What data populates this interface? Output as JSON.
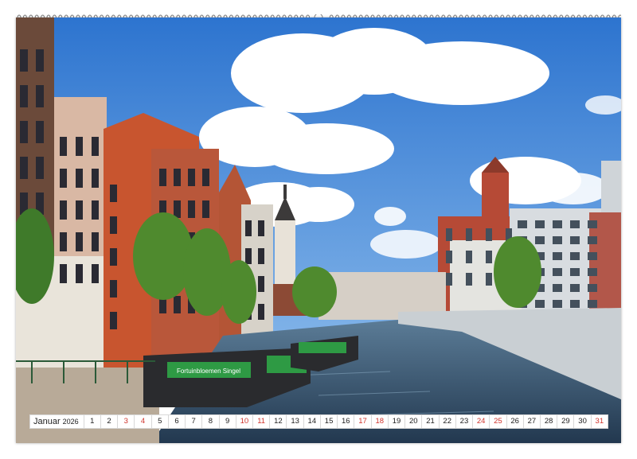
{
  "calendar": {
    "month": "Januar",
    "year": "2026",
    "days": [
      "1",
      "2",
      "3",
      "4",
      "5",
      "6",
      "7",
      "8",
      "9",
      "10",
      "11",
      "12",
      "13",
      "14",
      "15",
      "16",
      "17",
      "18",
      "19",
      "20",
      "21",
      "22",
      "23",
      "24",
      "25",
      "26",
      "27",
      "28",
      "29",
      "30",
      "31"
    ],
    "weekend_days": [
      "3",
      "4",
      "10",
      "11",
      "17",
      "18",
      "24",
      "25",
      "31"
    ]
  },
  "photo": {
    "boat_banner": "Fortuinbloemen Singel"
  },
  "colors": {
    "sky": "#3f86d6",
    "canal_water": "#2f4d6a",
    "boat_green": "#2e9a44",
    "weekend_red": "#d0342c"
  }
}
